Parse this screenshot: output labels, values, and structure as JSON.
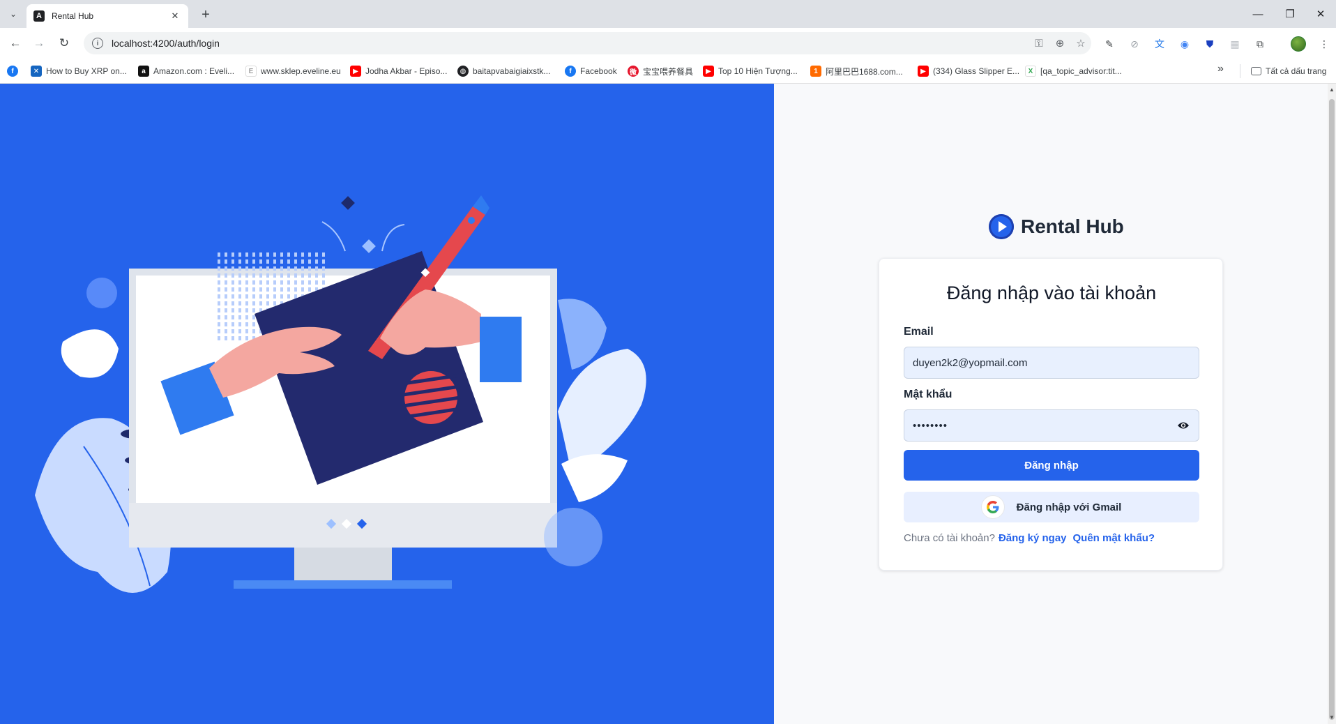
{
  "browser": {
    "tab_title": "Rental Hub",
    "tab_favicon": "A",
    "url": "localhost:4200/auth/login",
    "bookmarks": [
      {
        "label": "How to Buy XRP on...",
        "icon": "xrp-icon",
        "color": "#1565c0"
      },
      {
        "label": "Amazon.com : Eveli...",
        "icon": "amazon-icon",
        "color": "#111111"
      },
      {
        "label": "www.sklep.eveline.eu",
        "icon": "eveline-icon",
        "color": "#9e9e9e"
      },
      {
        "label": "Jodha Akbar - Episo...",
        "icon": "youtube-icon",
        "color": "#ff0000"
      },
      {
        "label": "baitapvabaigiaixstk...",
        "icon": "globe-icon",
        "color": "#202124"
      },
      {
        "label": "Facebook",
        "icon": "facebook-icon",
        "color": "#1877f2"
      },
      {
        "label": "宝宝喂养餐具",
        "icon": "weibo-icon",
        "color": "#e6162d"
      },
      {
        "label": "Top 10 Hiện Tượng...",
        "icon": "youtube-icon",
        "color": "#ff0000"
      },
      {
        "label": "阿里巴巴1688.com...",
        "icon": "alibaba-icon",
        "color": "#ff6a00"
      },
      {
        "label": "(334) Glass Slipper E...",
        "icon": "youtube-icon",
        "color": "#ff0000"
      },
      {
        "label": "[qa_topic_advisor:tit...",
        "icon": "cx-icon",
        "color": "#34a853"
      }
    ],
    "all_bookmarks_label": "Tất cả dấu trang"
  },
  "auth": {
    "brand_name": "Rental Hub",
    "title": "Đăng nhập vào tài khoản",
    "email_label": "Email",
    "email_value": "duyen2k2@yopmail.com",
    "password_label": "Mật khẩu",
    "password_masked": "••••••••",
    "login_button": "Đăng nhập",
    "google_button": "Đăng nhập với Gmail",
    "no_account_text": "Chưa có tài khoản?",
    "register_link": "Đăng ký ngay",
    "forgot_link": "Quên mật khẩu?"
  },
  "colors": {
    "hero_bg": "#2563eb",
    "primary": "#2563eb",
    "input_bg": "#e8f0fe"
  }
}
